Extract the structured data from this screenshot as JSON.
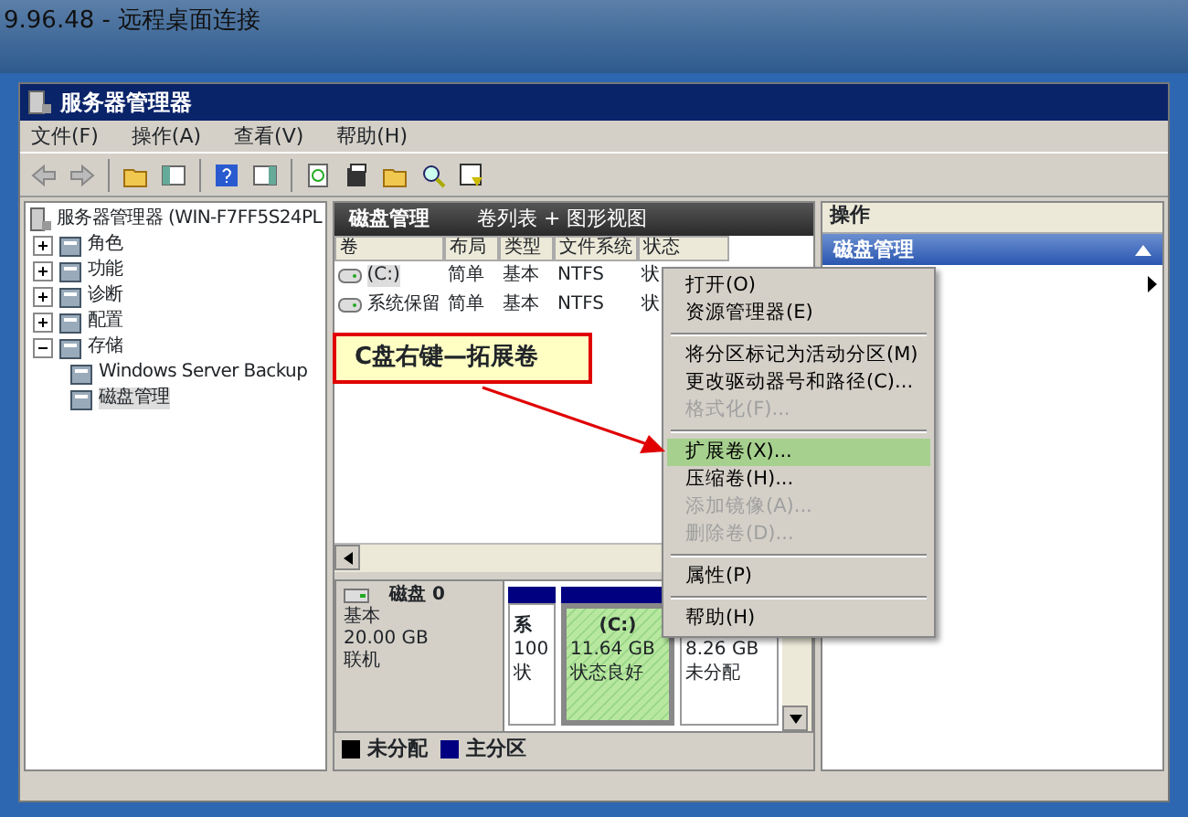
{
  "rdp_window": {
    "title": "9.96.48 - 远程桌面连接"
  },
  "window": {
    "title": "服务器管理器"
  },
  "menu_bar": [
    "文件(F)",
    "操作(A)",
    "查看(V)",
    "帮助(H)"
  ],
  "tree": {
    "label": "服务器管理器 (WIN-F7FF5S24PL",
    "children": [
      {
        "label": "角色",
        "expanded": false,
        "selected": false
      },
      {
        "label": "功能",
        "expanded": false,
        "selected": false
      },
      {
        "label": "诊断",
        "expanded": false,
        "selected": false
      },
      {
        "label": "配置",
        "expanded": false,
        "selected": false
      },
      {
        "label": "存储",
        "expanded": true,
        "selected": false,
        "children": [
          {
            "label": "Windows Server Backup",
            "selected": false
          },
          {
            "label": "磁盘管理",
            "selected": true
          }
        ]
      }
    ]
  },
  "center": {
    "title": "磁盘管理",
    "subtitle": "卷列表 + 图形视图",
    "columns": [
      "卷",
      "布局",
      "类型",
      "文件系统",
      "状态"
    ],
    "rows": [
      {
        "cells": [
          "(C:)",
          "简单",
          "基本",
          "NTFS",
          "状"
        ],
        "selected": true
      },
      {
        "cells": [
          "系统保留",
          "简单",
          "基本",
          "NTFS",
          "状"
        ],
        "selected": false
      }
    ]
  },
  "disk": {
    "label": "磁盘 0",
    "type": "基本",
    "size": "20.00 GB",
    "status": "联机",
    "partitions": [
      {
        "kind": "primary",
        "lines": [
          "系",
          "100",
          "状"
        ],
        "selected": false
      },
      {
        "kind": "primary",
        "lines": [
          "(C:)",
          "11.64 GB",
          "状态良好"
        ],
        "selected": true
      },
      {
        "kind": "unallocated",
        "lines": [
          "8.26 GB",
          "未分配"
        ],
        "selected": false
      }
    ]
  },
  "legend": [
    {
      "label": "未分配",
      "color": "#000000"
    },
    {
      "label": "主分区",
      "color": "#000080"
    }
  ],
  "actions": {
    "title": "操作",
    "section": "磁盘管理",
    "expanded": true
  },
  "context_menu": [
    {
      "kind": "item",
      "label": "打开(O)",
      "disabled": false,
      "selected": false
    },
    {
      "kind": "item",
      "label": "资源管理器(E)",
      "disabled": false,
      "selected": false
    },
    {
      "kind": "separator"
    },
    {
      "kind": "item",
      "label": "将分区标记为活动分区(M)",
      "disabled": false,
      "selected": false
    },
    {
      "kind": "item",
      "label": "更改驱动器号和路径(C)...",
      "disabled": false,
      "selected": false
    },
    {
      "kind": "item",
      "label": "格式化(F)...",
      "disabled": true,
      "selected": false
    },
    {
      "kind": "separator"
    },
    {
      "kind": "item",
      "label": "扩展卷(X)...",
      "disabled": false,
      "selected": true
    },
    {
      "kind": "item",
      "label": "压缩卷(H)...",
      "disabled": false,
      "selected": false
    },
    {
      "kind": "item",
      "label": "添加镜像(A)...",
      "disabled": true,
      "selected": false
    },
    {
      "kind": "item",
      "label": "删除卷(D)...",
      "disabled": true,
      "selected": false
    },
    {
      "kind": "separator"
    },
    {
      "kind": "item",
      "label": "属性(P)",
      "disabled": false,
      "selected": false
    },
    {
      "kind": "separator"
    },
    {
      "kind": "item",
      "label": "帮助(H)",
      "disabled": false,
      "selected": false
    }
  ],
  "callout": {
    "text": "C盘右键—拓展卷"
  }
}
